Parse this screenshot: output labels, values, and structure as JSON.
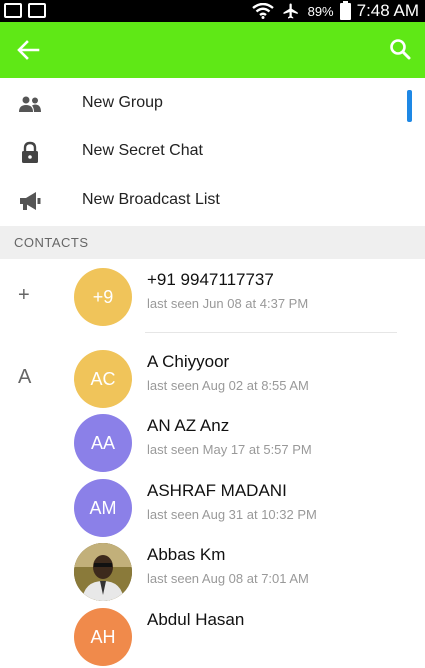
{
  "status_bar": {
    "battery": "89%",
    "time": "7:48 AM"
  },
  "menu": [
    {
      "label": "New Group",
      "icon": "group-icon"
    },
    {
      "label": "New Secret Chat",
      "icon": "lock-icon"
    },
    {
      "label": "New Broadcast List",
      "icon": "megaphone-icon"
    }
  ],
  "section_header": "CONTACTS",
  "index_letters": {
    "plus": "+",
    "a": "A"
  },
  "contacts": [
    {
      "name": "+91 9947117737",
      "last_seen": "last seen Jun 08 at 4:37 PM",
      "initials": "+9",
      "color": "#f0c45a"
    },
    {
      "name": "A Chiyyoor",
      "last_seen": "last seen Aug 02 at 8:55 AM",
      "initials": "AC",
      "color": "#f0c45a"
    },
    {
      "name": "AN AZ Anz",
      "last_seen": "last seen May 17 at 5:57 PM",
      "initials": "AA",
      "color": "#8b80e8"
    },
    {
      "name": "ASHRAF MADANI",
      "last_seen": "last seen Aug 31 at 10:32 PM",
      "initials": "AM",
      "color": "#8b80e8"
    },
    {
      "name": "Abbas Km",
      "last_seen": "last seen Aug 08 at 7:01 AM",
      "initials": "",
      "color": "#6b5a2e"
    },
    {
      "name": "Abdul Hasan",
      "last_seen": "",
      "initials": "AH",
      "color": "#f08a4b"
    }
  ],
  "colors": {
    "appbar": "#5fe816",
    "accent": "#1e88e5"
  }
}
